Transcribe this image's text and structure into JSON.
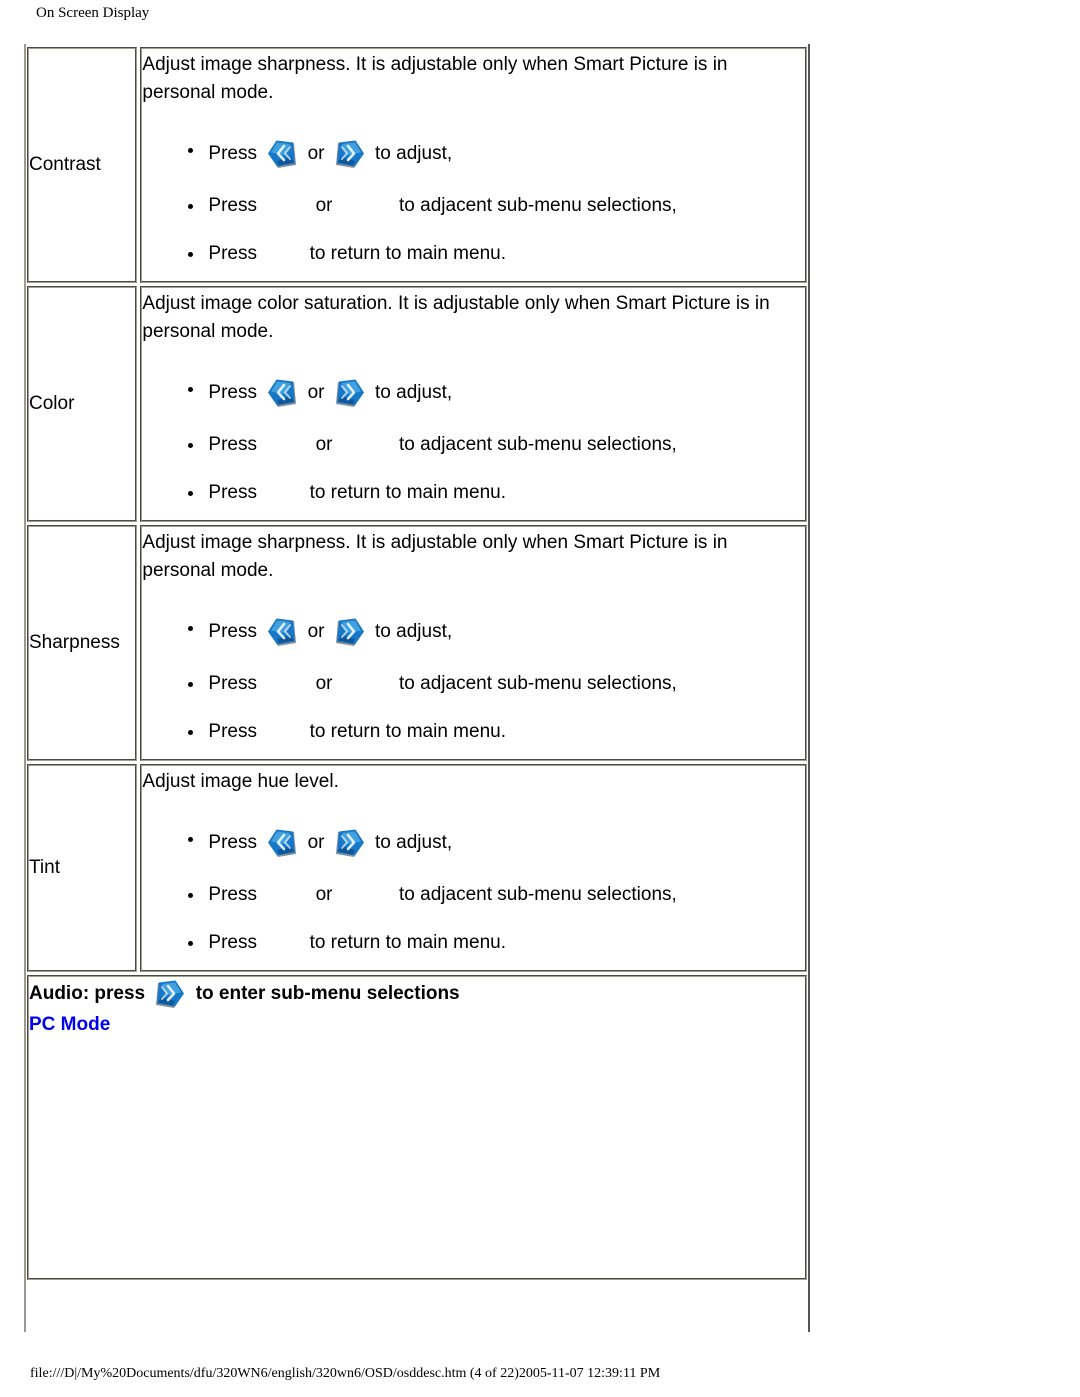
{
  "page": {
    "header": "On Screen Display",
    "footer": "file:///D|/My%20Documents/dfu/320WN6/english/320wn6/OSD/osddesc.htm (4 of 22)2005-11-07 12:39:11 PM"
  },
  "colors": {
    "gem_blue_light": "#4aa8e0",
    "gem_blue": "#1878c8",
    "gem_blue_dark": "#0d4f8c",
    "gem_edge": "#8c8c8c",
    "link_blue": "#0000ee",
    "table_border": "#a09e8e",
    "text": "#000000"
  },
  "icons": {
    "left_key": "chevron-left-key-icon",
    "right_key": "chevron-right-key-icon"
  },
  "table": {
    "rows": [
      {
        "name": "Contrast",
        "description": "Adjust image sharpness. It is adjustable only when Smart Picture is in personal mode.",
        "steps": [
          {
            "prefix": "Press",
            "icon_left": "chevron-left-key-icon",
            "middle": "or",
            "icon_right": "chevron-right-key-icon",
            "suffix": "to adjust,"
          },
          {
            "prefix": "Press",
            "icon_left": "",
            "middle": "or",
            "icon_right": "",
            "suffix": "to adjacent sub-menu selections,"
          },
          {
            "prefix": "Press",
            "icon_left": "",
            "middle": "",
            "icon_right": "",
            "suffix": "to return to main menu."
          }
        ]
      },
      {
        "name": "Color",
        "description": "Adjust image color saturation. It is adjustable only when Smart Picture is in personal mode.",
        "steps": [
          {
            "prefix": "Press",
            "icon_left": "chevron-left-key-icon",
            "middle": "or",
            "icon_right": "chevron-right-key-icon",
            "suffix": "to adjust,"
          },
          {
            "prefix": "Press",
            "icon_left": "",
            "middle": "or",
            "icon_right": "",
            "suffix": "to adjacent sub-menu selections,"
          },
          {
            "prefix": "Press",
            "icon_left": "",
            "middle": "",
            "icon_right": "",
            "suffix": "to return to main menu."
          }
        ]
      },
      {
        "name": "Sharpness",
        "description": "Adjust image sharpness. It is adjustable only when Smart Picture is in personal mode.",
        "steps": [
          {
            "prefix": "Press",
            "icon_left": "chevron-left-key-icon",
            "middle": "or",
            "icon_right": "chevron-right-key-icon",
            "suffix": "to adjust,"
          },
          {
            "prefix": "Press",
            "icon_left": "",
            "middle": "or",
            "icon_right": "",
            "suffix": "to adjacent sub-menu selections,"
          },
          {
            "prefix": "Press",
            "icon_left": "",
            "middle": "",
            "icon_right": "",
            "suffix": "to return to main menu."
          }
        ]
      },
      {
        "name": "Tint",
        "description": "Adjust image hue level.",
        "steps": [
          {
            "prefix": "Press",
            "icon_left": "chevron-left-key-icon",
            "middle": "or",
            "icon_right": "chevron-right-key-icon",
            "suffix": "to adjust,"
          },
          {
            "prefix": "Press",
            "icon_left": "",
            "middle": "or",
            "icon_right": "",
            "suffix": "to adjacent sub-menu selections,"
          },
          {
            "prefix": "Press",
            "icon_left": "",
            "middle": "",
            "icon_right": "",
            "suffix": "to return to main menu."
          }
        ]
      }
    ],
    "audio_row": {
      "label_before": "Audio: press",
      "icon": "chevron-right-key-icon",
      "label_after": "to enter sub-menu selections",
      "link": "PC Mode"
    }
  }
}
